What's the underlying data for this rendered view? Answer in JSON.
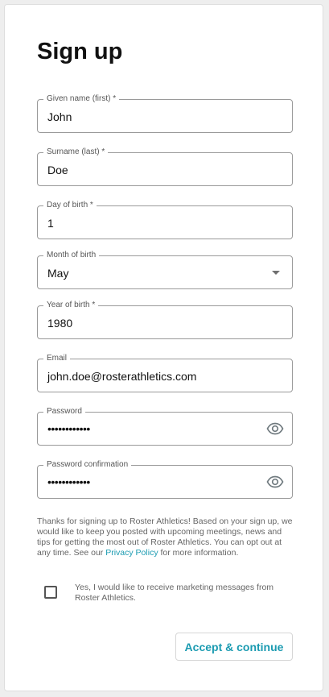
{
  "form": {
    "title": "Sign up",
    "fields": [
      {
        "label": "Given name (first) *",
        "value": "John"
      },
      {
        "label": "Surname (last) *",
        "value": "Doe"
      },
      {
        "label": "Day of birth *",
        "value": "1"
      },
      {
        "label": "Month of birth",
        "value": "May"
      },
      {
        "label": "Year of birth *",
        "value": "1980"
      },
      {
        "label": "Email",
        "value": "john.doe@rosterathletics.com"
      },
      {
        "label": "Password",
        "value": "••••••••••••"
      },
      {
        "label": "Password confirmation",
        "value": "••••••••••••"
      }
    ],
    "notice": {
      "text_before": "Thanks for signing up to Roster Athletics! Based on your sign up, we would like to keep you posted with upcoming meetings, news and tips for getting the most out of Roster Athletics. You can opt out at any time. See our ",
      "link": "Privacy Policy",
      "text_after": " for more information."
    },
    "marketing_checkbox": {
      "label": "Yes, I would like to receive marketing messages from Roster Athletics.",
      "checked": false
    },
    "submit_label": "Accept & continue"
  },
  "colors": {
    "accent": "#1b9bb1",
    "border": "#9a9a9a",
    "text": "#111111",
    "muted": "#666666"
  },
  "icons": {
    "password_visibility": "eye-icon",
    "dropdown": "chevron-down-icon"
  }
}
